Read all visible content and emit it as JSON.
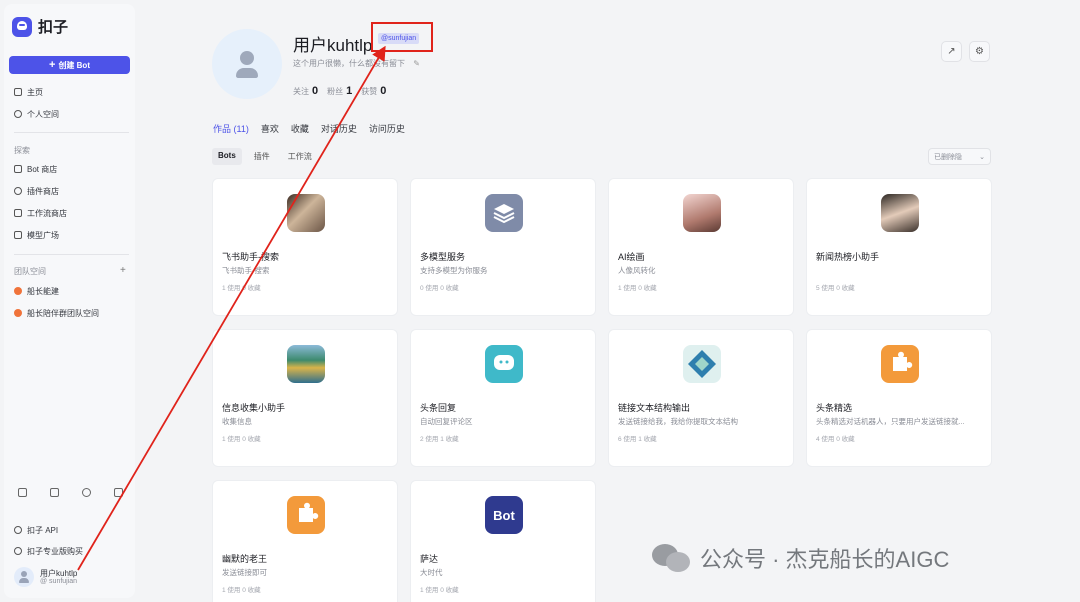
{
  "sidebar": {
    "logo": "扣子",
    "create_label": "创建 Bot",
    "nav": [
      "主页",
      "个人空间"
    ],
    "explore_label": "探索",
    "explore_items": [
      "Bot 商店",
      "插件商店",
      "工作流商店",
      "模型广场"
    ],
    "team_label": "团队空间",
    "teams": [
      "船长能建",
      "船长陪伴群团队空间"
    ],
    "footer_links": [
      "扣子 API",
      "扣子专业版购买"
    ],
    "user": {
      "name": "用户kuhtlp",
      "handle": "@ sunfujian"
    }
  },
  "profile": {
    "name": "用户kuhtlp",
    "handle": "@sunfujian",
    "desc": "这个用户很懒，什么都没有留下",
    "stats": [
      {
        "label": "关注",
        "value": "0"
      },
      {
        "label": "粉丝",
        "value": "1"
      },
      {
        "label": "获赞",
        "value": "0"
      }
    ]
  },
  "tabs": [
    "作品 (11)",
    "喜欢",
    "收藏",
    "对话历史",
    "访问历史"
  ],
  "subtabs": [
    "Bots",
    "插件",
    "工作流"
  ],
  "filter_label": "已删除隐",
  "cards": [
    {
      "title": "飞书助手-搜索",
      "desc": "飞书助手-搜索",
      "stats": "1 使用  0 收藏",
      "icon": "photo-woman"
    },
    {
      "title": "多模型服务",
      "desc": "支持多模型为你服务",
      "stats": "0 使用  0 收藏",
      "icon": "layers"
    },
    {
      "title": "AI绘画",
      "desc": "人像风转化",
      "stats": "1 使用  0 收藏",
      "icon": "photo-girl"
    },
    {
      "title": "新闻热榜小助手",
      "desc": "",
      "stats": "5 使用  0 收藏",
      "icon": "photo-girl2"
    },
    {
      "title": "信息收集小助手",
      "desc": "收集信息",
      "stats": "1 使用  0 收藏",
      "icon": "landscape"
    },
    {
      "title": "头条回复",
      "desc": "自动回复评论区",
      "stats": "2 使用  1 收藏",
      "icon": "chat"
    },
    {
      "title": "链接文本结构输出",
      "desc": "发送链接给我，我给你提取文本结构",
      "stats": "6 使用  1 收藏",
      "icon": "diamond"
    },
    {
      "title": "头条精选",
      "desc": "头条精选对话机器人，只要用户发送链接就...",
      "stats": "4 使用  0 收藏",
      "icon": "puzzle"
    },
    {
      "title": "幽默的老王",
      "desc": "发送链接即可",
      "stats": "1 使用  0 收藏",
      "icon": "puzzle"
    },
    {
      "title": "萨达",
      "desc": "大时代",
      "stats": "1 使用  0 收藏",
      "icon": "bot",
      "icon_text": "Bot"
    }
  ],
  "watermark": "公众号 · 杰克船长的AIGC",
  "colors": {
    "accent": "#4d53e8",
    "annotation": "#e0231b"
  }
}
